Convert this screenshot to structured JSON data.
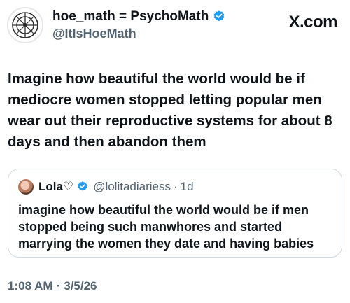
{
  "author": {
    "display_name": "hoe_math = PsychoMath",
    "handle": "@ItIsHoeMath",
    "verified": true
  },
  "brand": {
    "label": "X.com"
  },
  "tweet": {
    "text": "Imagine how beautiful the world would be if mediocre women stopped letting popular men wear out their reproductive systems for about 8 days and then abandon them",
    "time": "1:08 AM",
    "separator": "·",
    "date": "3/5/26"
  },
  "quote": {
    "display_name": "Lola♡",
    "handle": "@lolitadiariess",
    "separator": "·",
    "age": "1d",
    "verified": true,
    "text": "imagine how beautiful the world would be if men stopped being such manwhores and started marrying the women they date and having babies"
  },
  "colors": {
    "verified": "#1d9bf0",
    "secondary_text": "#536471",
    "border": "#cfd9de"
  }
}
